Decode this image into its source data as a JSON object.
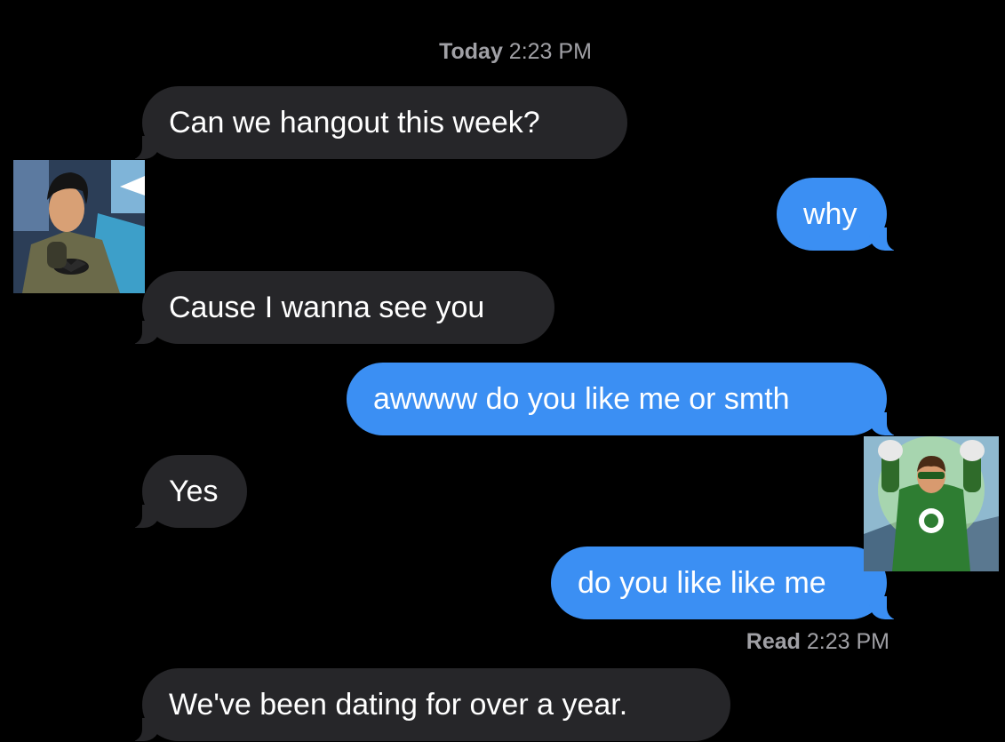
{
  "conversation": {
    "timestamp": {
      "day": "Today",
      "time": "2:23 PM"
    },
    "messages": [
      {
        "direction": "incoming",
        "text": "Can we hangout this week?"
      },
      {
        "direction": "outgoing",
        "text": "why"
      },
      {
        "direction": "incoming",
        "text": "Cause I wanna see you"
      },
      {
        "direction": "outgoing",
        "text": "awwww do you like me or smth"
      },
      {
        "direction": "incoming",
        "text": "Yes"
      },
      {
        "direction": "outgoing",
        "text": "do you like like me"
      },
      {
        "direction": "incoming",
        "text": "We've been dating for over a year."
      }
    ],
    "read_receipt": {
      "label": "Read",
      "time": "2:23 PM"
    }
  },
  "avatars": {
    "sender": {
      "icon": "batman-comic-avatar"
    },
    "recipient": {
      "icon": "green-lantern-comic-avatar"
    }
  },
  "colors": {
    "background": "#000000",
    "incoming_bubble": "#262629",
    "outgoing_bubble": "#3b8ff3",
    "meta_text": "#a0a0a5"
  }
}
